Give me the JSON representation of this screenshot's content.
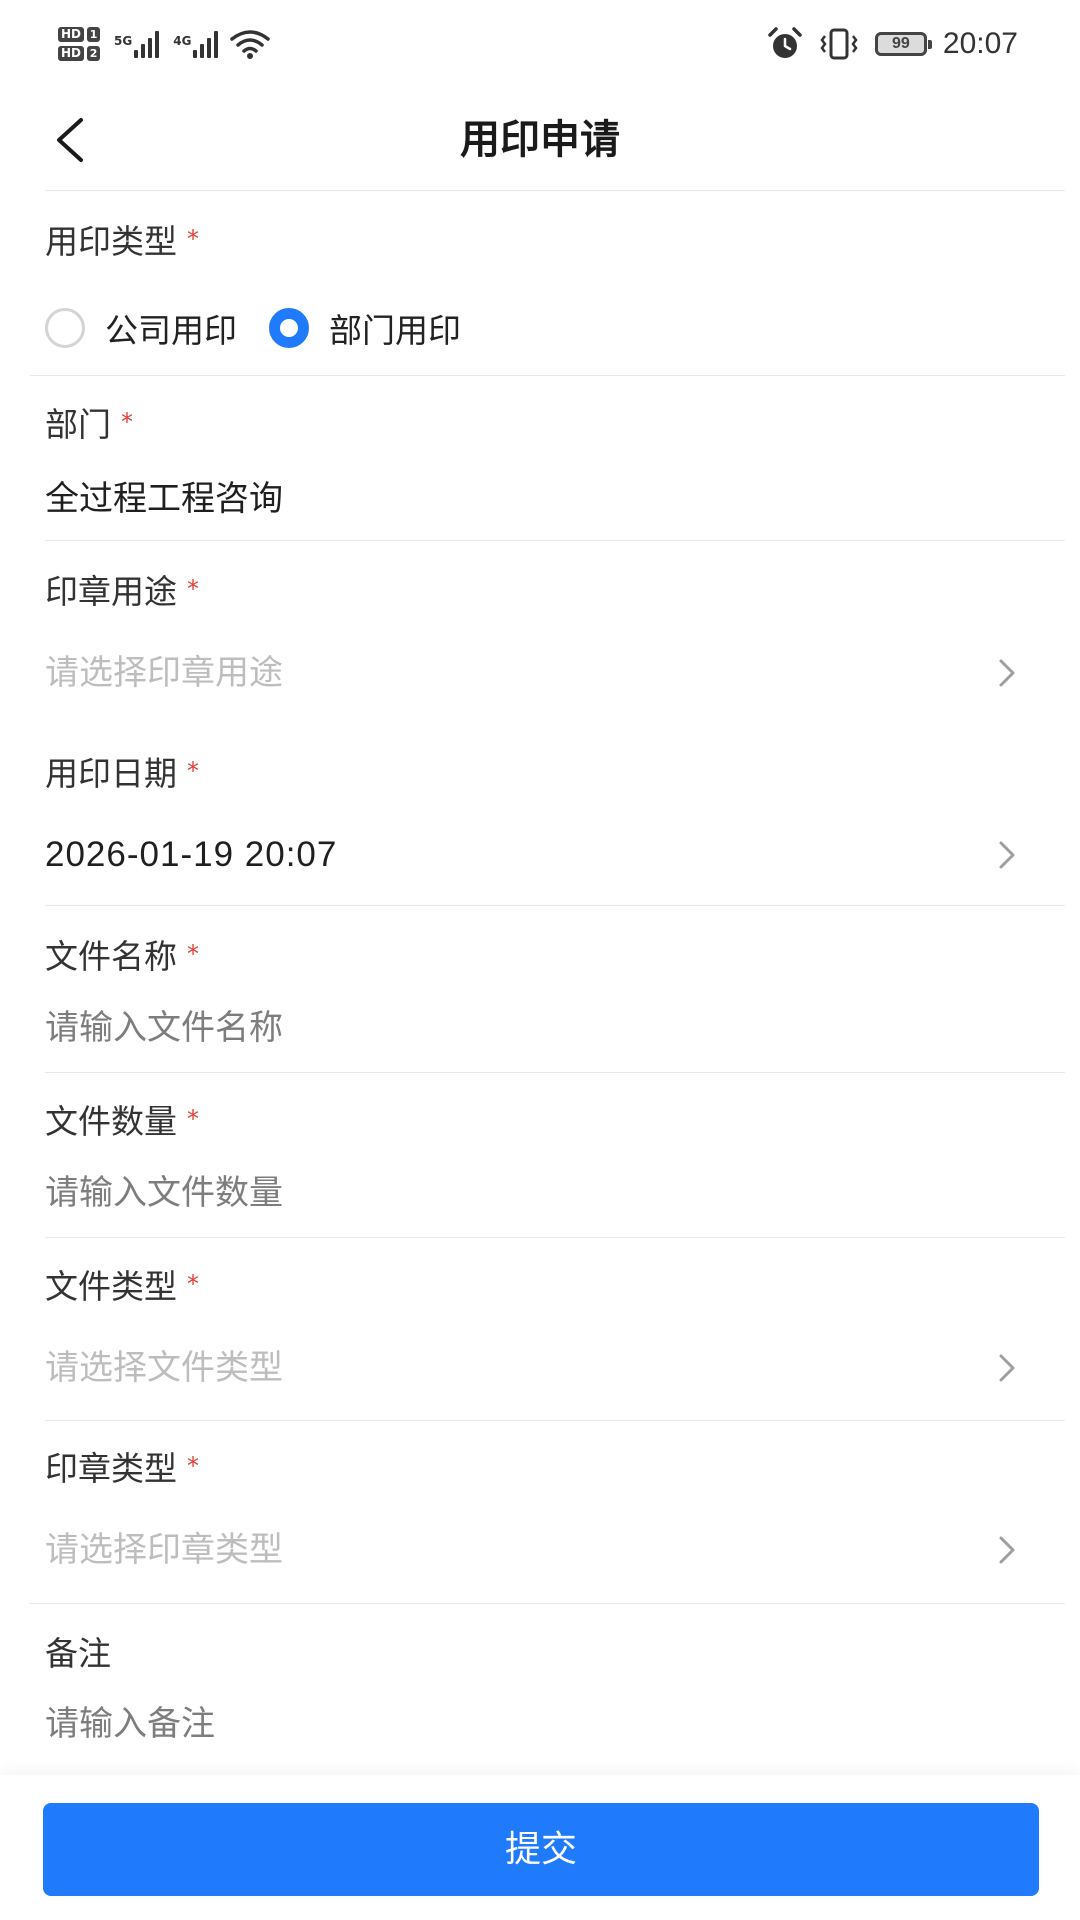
{
  "status_bar": {
    "sim1": "1",
    "sim2": "2",
    "hd1": "HD",
    "hd2": "HD",
    "net1": "5G",
    "net2": "4G",
    "battery": "99",
    "time": "20:07"
  },
  "nav": {
    "title": "用印申请"
  },
  "form": {
    "seal_kind": {
      "label": "用印类型",
      "required": "*",
      "options": [
        {
          "label": "公司用印",
          "selected": false
        },
        {
          "label": "部门用印",
          "selected": true
        }
      ]
    },
    "department": {
      "label": "部门",
      "required": "*",
      "value": "全过程工程咨询"
    },
    "seal_purpose": {
      "label": "印章用途",
      "required": "*",
      "placeholder": "请选择印章用途"
    },
    "seal_date": {
      "label": "用印日期",
      "required": "*",
      "value": "2026-01-19 20:07"
    },
    "file_name": {
      "label": "文件名称",
      "required": "*",
      "placeholder": "请输入文件名称"
    },
    "file_count": {
      "label": "文件数量",
      "required": "*",
      "placeholder": "请输入文件数量"
    },
    "file_type": {
      "label": "文件类型",
      "required": "*",
      "placeholder": "请选择文件类型"
    },
    "seal_type": {
      "label": "印章类型",
      "required": "*",
      "placeholder": "请选择印章类型"
    },
    "remark": {
      "label": "备注",
      "placeholder": "请输入备注"
    }
  },
  "footer": {
    "submit_label": "提交"
  },
  "colors": {
    "accent": "#1f7bfb",
    "required": "#e0403a",
    "placeholder": "#bdbdbd",
    "divider": "#e9e9e9"
  },
  "icons": {
    "back": "chevron-left-icon",
    "disclosure": "chevron-right-icon"
  }
}
